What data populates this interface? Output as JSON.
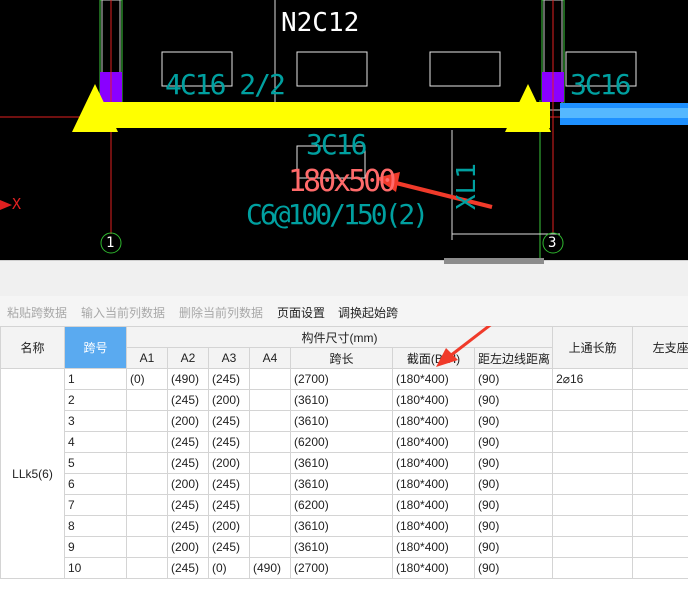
{
  "cad": {
    "top_label": "N2C12",
    "left_rebar": "4C16 2/2",
    "right_rebar": "3C16",
    "mid_top": "3C16",
    "beam_size": "180x500",
    "stirrup": "C6@100/150(2)",
    "beam_tag": "XL1",
    "axis_x": "X",
    "axis_1": "1",
    "axis_3": "3",
    "colors": {
      "beam": "#ffff00",
      "column": "#8a00ff",
      "annot": "#00a0a0",
      "size": "#ff6a6a",
      "arrow": "#f03a2a"
    }
  },
  "toolbar": {
    "paste": "粘贴跨数据",
    "input_col": "输入当前列数据",
    "delete_col": "删除当前列数据",
    "page_setup": "页面设置",
    "swap_start": "调换起始跨"
  },
  "grid": {
    "headers": {
      "name": "名称",
      "span_no": "跨号",
      "group": "构件尺寸(mm)",
      "a1": "A1",
      "a2": "A2",
      "a3": "A3",
      "a4": "A4",
      "span_len": "跨长",
      "section": "截面(B*H)",
      "edge_dist": "距左边线距离",
      "top_bar": "上通长筋",
      "left_seat": "左支座钢"
    },
    "member_name": "LLk5(6)",
    "rows": [
      {
        "no": "1",
        "a1": "(0)",
        "a2": "(490)",
        "a3": "(245)",
        "a4": "",
        "len": "(2700)",
        "sec": "(180*400)",
        "dist": "(90)",
        "bar": "2⌀16"
      },
      {
        "no": "2",
        "a1": "",
        "a2": "(245)",
        "a3": "(200)",
        "a4": "",
        "len": "(3610)",
        "sec": "(180*400)",
        "dist": "(90)",
        "bar": ""
      },
      {
        "no": "3",
        "a1": "",
        "a2": "(200)",
        "a3": "(245)",
        "a4": "",
        "len": "(3610)",
        "sec": "(180*400)",
        "dist": "(90)",
        "bar": ""
      },
      {
        "no": "4",
        "a1": "",
        "a2": "(245)",
        "a3": "(245)",
        "a4": "",
        "len": "(6200)",
        "sec": "(180*400)",
        "dist": "(90)",
        "bar": ""
      },
      {
        "no": "5",
        "a1": "",
        "a2": "(245)",
        "a3": "(200)",
        "a4": "",
        "len": "(3610)",
        "sec": "(180*400)",
        "dist": "(90)",
        "bar": ""
      },
      {
        "no": "6",
        "a1": "",
        "a2": "(200)",
        "a3": "(245)",
        "a4": "",
        "len": "(3610)",
        "sec": "(180*400)",
        "dist": "(90)",
        "bar": ""
      },
      {
        "no": "7",
        "a1": "",
        "a2": "(245)",
        "a3": "(245)",
        "a4": "",
        "len": "(6200)",
        "sec": "(180*400)",
        "dist": "(90)",
        "bar": ""
      },
      {
        "no": "8",
        "a1": "",
        "a2": "(245)",
        "a3": "(200)",
        "a4": "",
        "len": "(3610)",
        "sec": "(180*400)",
        "dist": "(90)",
        "bar": ""
      },
      {
        "no": "9",
        "a1": "",
        "a2": "(200)",
        "a3": "(245)",
        "a4": "",
        "len": "(3610)",
        "sec": "(180*400)",
        "dist": "(90)",
        "bar": ""
      },
      {
        "no": "10",
        "a1": "",
        "a2": "(245)",
        "a3": "(0)",
        "a4": "(490)",
        "len": "(2700)",
        "sec": "(180*400)",
        "dist": "(90)",
        "bar": ""
      }
    ]
  }
}
